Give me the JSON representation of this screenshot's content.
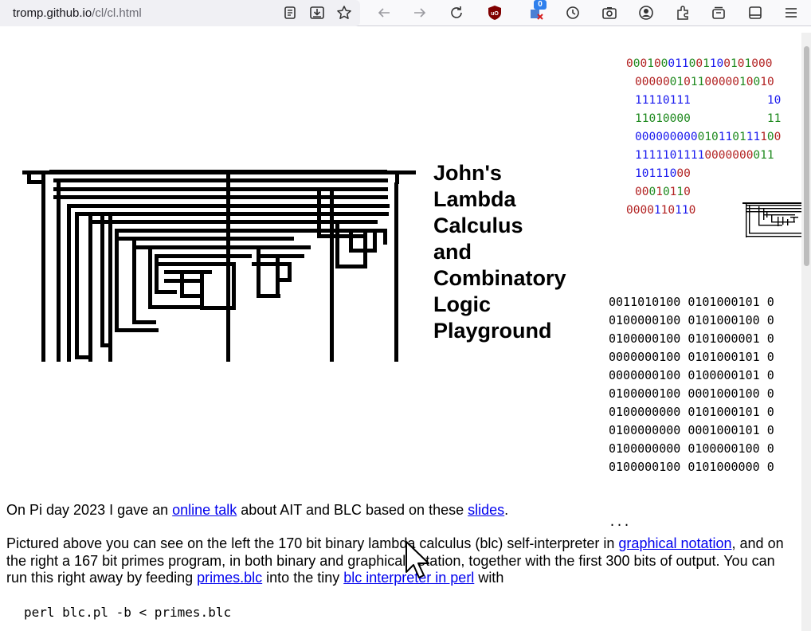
{
  "browser": {
    "url_host": "tromp.github.io",
    "url_path": "/cl/cl.html",
    "extension_badge": "0",
    "icons": [
      "reader-view-icon",
      "save-to-pocket-icon",
      "bookmark-star-icon",
      "back-arrow-icon",
      "forward-arrow-icon",
      "reload-icon",
      "ublock-icon",
      "container-extension-icon",
      "history-icon",
      "screenshot-icon",
      "account-icon",
      "extensions-icon",
      "collections-icon",
      "sidebar-icon",
      "menu-icon"
    ]
  },
  "heading": {
    "lines": [
      "John's",
      "Lambda",
      "Calculus",
      "and",
      "Combinatory",
      "Logic",
      "Playground"
    ]
  },
  "binary_lines": [
    [
      [
        "r",
        "0"
      ],
      [
        "g",
        "0"
      ],
      [
        "r",
        "0"
      ],
      [
        "g",
        "1"
      ],
      [
        "r",
        "0"
      ],
      [
        "g",
        "0"
      ],
      [
        "b",
        "0"
      ],
      [
        "b",
        "1"
      ],
      [
        "b",
        "1"
      ],
      [
        "g",
        "0"
      ],
      [
        "r",
        "0"
      ],
      [
        "g",
        "1"
      ],
      [
        "b",
        "1"
      ],
      [
        "b",
        "0"
      ],
      [
        "r",
        "0"
      ],
      [
        "g",
        "1"
      ],
      [
        "r",
        "0"
      ],
      [
        "g",
        "1"
      ],
      [
        "r",
        "0"
      ],
      [
        "r",
        "0"
      ],
      [
        "r",
        "0"
      ]
    ],
    [
      [
        "r",
        "0"
      ],
      [
        "r",
        "0"
      ],
      [
        "r",
        "0"
      ],
      [
        "r",
        "0"
      ],
      [
        "r",
        "0"
      ],
      [
        "g",
        "0"
      ],
      [
        "g",
        "1"
      ],
      [
        "r",
        "0"
      ],
      [
        "g",
        "1"
      ],
      [
        "g",
        "1"
      ],
      [
        "r",
        "0"
      ],
      [
        "r",
        "0"
      ],
      [
        "r",
        "0"
      ],
      [
        "r",
        "0"
      ],
      [
        "r",
        "0"
      ],
      [
        "g",
        "1"
      ],
      [
        "r",
        "0"
      ],
      [
        "g",
        "0"
      ],
      [
        "r",
        "1"
      ],
      [
        "r",
        "0"
      ]
    ],
    [
      [
        "b",
        "11110111           10"
      ]
    ],
    [
      [
        "g",
        "11010000           11"
      ]
    ],
    [
      [
        "b",
        "000000000"
      ],
      [
        "g",
        "0"
      ],
      [
        "g",
        "1"
      ],
      [
        "g",
        "0"
      ],
      [
        "b",
        "1"
      ],
      [
        "b",
        "1"
      ],
      [
        "g",
        "0"
      ],
      [
        "g",
        "1"
      ],
      [
        "b",
        "1"
      ],
      [
        "b",
        "1"
      ],
      [
        "r",
        "1"
      ],
      [
        "g",
        "0"
      ],
      [
        "r",
        "0"
      ]
    ],
    [
      [
        "b",
        "1111101111"
      ],
      [
        "r",
        "0000000"
      ],
      [
        "g",
        "011"
      ]
    ],
    [
      [
        "b",
        "101110"
      ],
      [
        "r",
        "00"
      ]
    ],
    [
      [
        "r",
        "00"
      ],
      [
        "g",
        "0"
      ],
      [
        "r",
        "1"
      ],
      [
        "g",
        "0"
      ],
      [
        "r",
        "1"
      ],
      [
        "g",
        "1"
      ],
      [
        "r",
        "0"
      ]
    ],
    [
      [
        "r",
        "0000"
      ],
      [
        "b",
        "1"
      ],
      [
        "r",
        "1"
      ],
      [
        "r",
        "0"
      ],
      [
        "b",
        "1"
      ],
      [
        "b",
        "1"
      ],
      [
        "r",
        "0"
      ]
    ]
  ],
  "primes_bits": [
    [
      "0011010100",
      "0101000101",
      "0"
    ],
    [
      "0100000100",
      "0101000100",
      "0"
    ],
    [
      "0100000100",
      "0101000001",
      "0"
    ],
    [
      "0000000100",
      "0101000101",
      "0"
    ],
    [
      "0000000100",
      "0100000101",
      "0"
    ],
    [
      "0100000100",
      "0001000100",
      "0"
    ],
    [
      "0100000000",
      "0101000101",
      "0"
    ],
    [
      "0100000000",
      "0001000101",
      "0"
    ],
    [
      "0100000000",
      "0100000100",
      "0"
    ],
    [
      "0100000100",
      "0101000000",
      "0"
    ]
  ],
  "primes_ellipsis": "...",
  "paragraph1": {
    "t1": "On Pi day 2023 I gave an ",
    "link1": "online talk",
    "t2": " about AIT and BLC based on these ",
    "link2": "slides",
    "t3": "."
  },
  "paragraph2": {
    "t1": "Pictured above you can see on the left the 170 bit binary lambda calculus (blc) self-interpreter in ",
    "link1": "graphical notation",
    "t2": ", and on the right a 167 bit primes program, in both binary and graphical notation, together with the first 300 bits of output. You can run this right away by feeding ",
    "link2": "primes.blc",
    "t3": " into the tiny ",
    "link3": "blc interpreter in perl",
    "t4": " with"
  },
  "command": "perl blc.pl -b < primes.blc"
}
